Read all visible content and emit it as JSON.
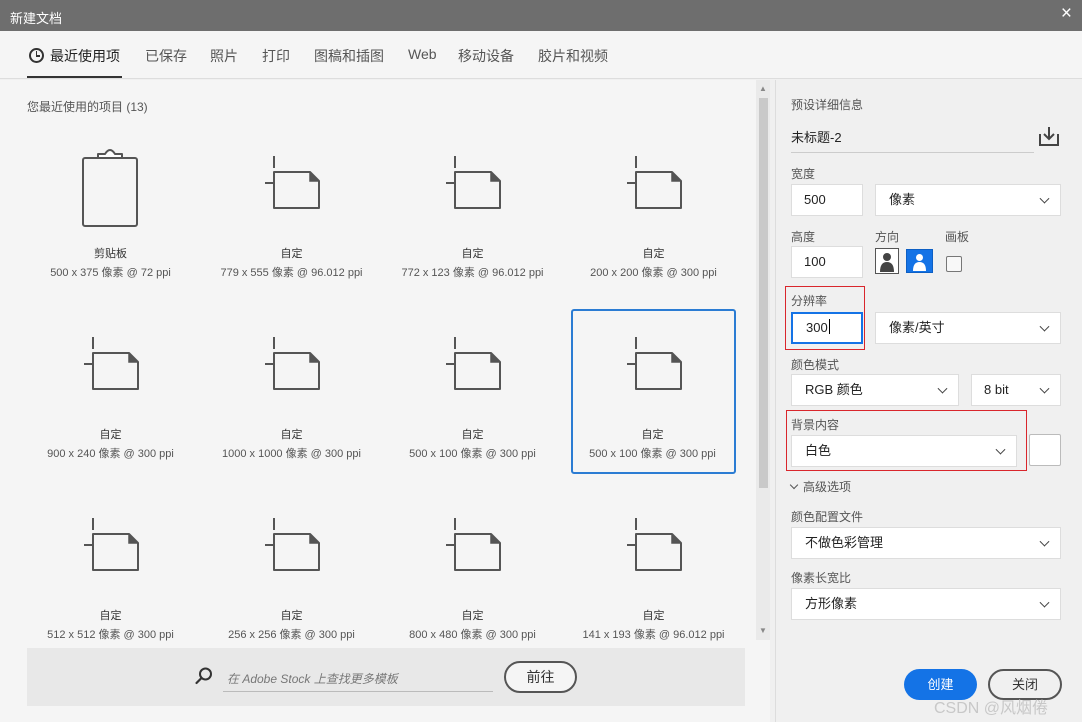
{
  "window": {
    "title": "新建文档",
    "close_glyph": "×"
  },
  "tabs": [
    {
      "label": "最近使用项",
      "icon": "clock-icon",
      "active": true
    },
    {
      "label": "已保存"
    },
    {
      "label": "照片"
    },
    {
      "label": "打印"
    },
    {
      "label": "图稿和插图"
    },
    {
      "label": "Web"
    },
    {
      "label": "移动设备"
    },
    {
      "label": "胶片和视频"
    }
  ],
  "recent": {
    "title": "您最近使用的项目 (13)",
    "items": [
      {
        "name": "剪贴板",
        "size": "500 x 375 像素 @ 72 ppi",
        "icon": "clipboard-icon"
      },
      {
        "name": "自定",
        "size": "779 x 555 像素 @ 96.012 ppi",
        "icon": "document-icon"
      },
      {
        "name": "自定",
        "size": "772 x 123 像素 @ 96.012 ppi",
        "icon": "document-icon"
      },
      {
        "name": "自定",
        "size": "200 x 200 像素 @ 300 ppi",
        "icon": "document-icon"
      },
      {
        "name": "自定",
        "size": "900 x 240 像素 @ 300 ppi",
        "icon": "document-icon"
      },
      {
        "name": "自定",
        "size": "1000 x 1000 像素 @ 300 ppi",
        "icon": "document-icon"
      },
      {
        "name": "自定",
        "size": "500 x 100 像素 @ 300 ppi",
        "icon": "document-icon"
      },
      {
        "name": "自定",
        "size": "500 x 100 像素 @ 300 ppi",
        "icon": "document-icon",
        "selected": true
      },
      {
        "name": "自定",
        "size": "512 x 512 像素 @ 300 ppi",
        "icon": "document-icon"
      },
      {
        "name": "自定",
        "size": "256 x 256 像素 @ 300 ppi",
        "icon": "document-icon"
      },
      {
        "name": "自定",
        "size": "800 x 480 像素 @ 300 ppi",
        "icon": "document-icon"
      },
      {
        "name": "自定",
        "size": "141 x 193 像素 @ 96.012 ppi",
        "icon": "document-icon"
      }
    ]
  },
  "stock": {
    "placeholder": "在 Adobe Stock 上查找更多模板",
    "button": "前往"
  },
  "preset": {
    "section_title": "预设详细信息",
    "doc_name": "未标题-2",
    "width_label": "宽度",
    "width_value": "500",
    "width_unit": "像素",
    "height_label": "高度",
    "height_value": "100",
    "orientation_label": "方向",
    "artboard_label": "画板",
    "resolution_label": "分辨率",
    "resolution_value": "300",
    "resolution_unit": "像素/英寸",
    "color_mode_label": "颜色模式",
    "color_mode": "RGB 颜色",
    "bit_depth": "8 bit",
    "background_label": "背景内容",
    "background": "白色",
    "advanced_label": "高级选项",
    "color_profile_label": "颜色配置文件",
    "color_profile": "不做色彩管理",
    "pixel_aspect_label": "像素长宽比",
    "pixel_aspect": "方形像素"
  },
  "buttons": {
    "create": "创建",
    "close": "关闭"
  },
  "watermark": "CSDN @风烟倦",
  "colors": {
    "accent": "#1473e6",
    "highlight": "#d9262c",
    "selection": "#2b7cd3"
  }
}
